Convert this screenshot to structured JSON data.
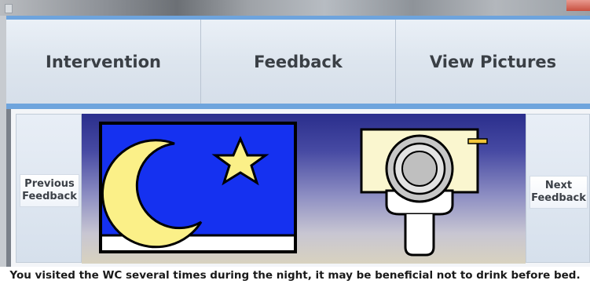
{
  "tabs": [
    {
      "label": "Intervention"
    },
    {
      "label": "Feedback"
    },
    {
      "label": "View Pictures"
    }
  ],
  "navigation": {
    "previous_label": "Previous\nFeedback",
    "next_label": "Next\nFeedback"
  },
  "pictures": {
    "left_icon": "moon-and-star-icon",
    "right_icon": "toilet-icon"
  },
  "feedback_message": "You visited the WC several times during the night, it may be beneficial not to drink before bed.",
  "colors": {
    "accent": "#6ea4dd",
    "tab_background": "#dfe6ef",
    "night_sky": "#1531f0",
    "moon_star": "#fbf088"
  }
}
